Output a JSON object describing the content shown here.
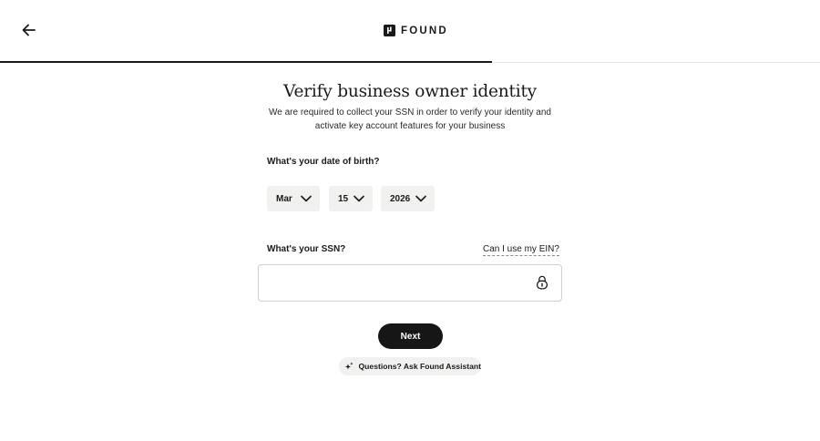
{
  "header": {
    "back_icon": "arrow-left-icon",
    "logo_text": "FOUND",
    "progress_fraction": 0.6
  },
  "main": {
    "title": "Verify business owner identity",
    "subtitle": "We are required to collect your SSN in order to verify your identity and activate key account features for your business",
    "dob": {
      "label": "What's your date of birth?",
      "month": "Mar",
      "day": "15",
      "year": "2026"
    },
    "ssn": {
      "label": "What's your SSN?",
      "ein_link": "Can I use my EIN?",
      "value": "",
      "placeholder": ""
    },
    "next_label": "Next",
    "assistant_label": "Questions? Ask Found Assistant"
  }
}
